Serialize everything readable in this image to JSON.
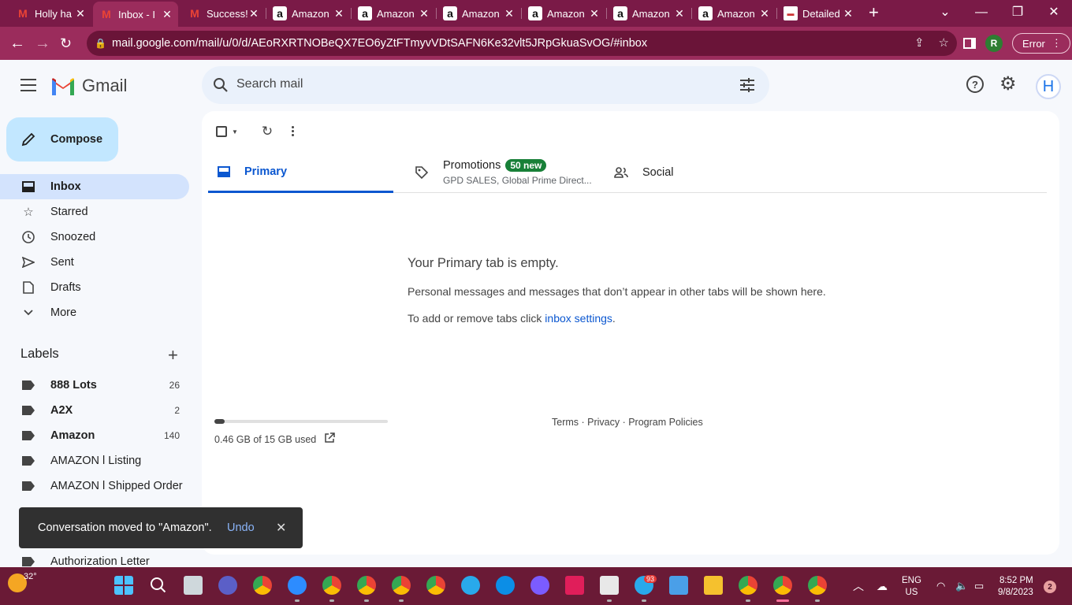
{
  "browser": {
    "tabs": [
      {
        "title": "Holly ha",
        "favicon": "gmail-icon"
      },
      {
        "title": "Inbox - I",
        "favicon": "gmail-icon",
        "active": true
      },
      {
        "title": "Success!",
        "favicon": "gmail-icon"
      },
      {
        "title": "Amazon",
        "favicon": "amazon-icon"
      },
      {
        "title": "Amazon",
        "favicon": "amazon-icon"
      },
      {
        "title": "Amazon",
        "favicon": "amazon-icon"
      },
      {
        "title": "Amazon",
        "favicon": "amazon-icon"
      },
      {
        "title": "Amazon",
        "favicon": "amazon-icon"
      },
      {
        "title": "Amazon",
        "favicon": "amazon-icon"
      },
      {
        "title": "Detailed",
        "favicon": "flag-icon"
      }
    ],
    "url": "mail.google.com/mail/u/0/d/AEoRXRTNOBeQX7EO6yZtFTmyvVDtSAFN6Ke32vlt5JRpGkuaSvOG/#inbox",
    "profile_initial": "R",
    "error_label": "Error",
    "accent_color": "#9b2c5c"
  },
  "gmail": {
    "brand": "Gmail",
    "search_placeholder": "Search mail",
    "avatar_initial": "H",
    "compose_label": "Compose",
    "nav": [
      {
        "label": "Inbox",
        "icon": "inbox-icon",
        "active": true
      },
      {
        "label": "Starred",
        "icon": "star-icon"
      },
      {
        "label": "Snoozed",
        "icon": "clock-icon"
      },
      {
        "label": "Sent",
        "icon": "send-icon"
      },
      {
        "label": "Drafts",
        "icon": "draft-icon"
      },
      {
        "label": "More",
        "icon": "chevron-down-icon"
      }
    ],
    "labels_title": "Labels",
    "labels": [
      {
        "name": "888 Lots",
        "count": "26",
        "bold": true
      },
      {
        "name": "A2X",
        "count": "2",
        "bold": true
      },
      {
        "name": "Amazon",
        "count": "140",
        "bold": true
      },
      {
        "name": "AMAZON l Listing",
        "count": ""
      },
      {
        "name": "AMAZON l Shipped Order",
        "count": ""
      },
      {
        "name": "Authorization Letter",
        "count": ""
      }
    ],
    "tabs": {
      "primary": "Primary",
      "promotions": "Promotions",
      "promotions_badge": "50 new",
      "promotions_sub": "GPD SALES, Global Prime Direct...",
      "social": "Social"
    },
    "empty": {
      "heading": "Your Primary tab is empty.",
      "line1": "Personal messages and messages that don’t appear in other tabs will be shown here.",
      "line2_prefix": "To add or remove tabs click ",
      "line2_link": "inbox settings",
      "line2_suffix": "."
    },
    "storage": {
      "text": "0.46 GB of 15 GB used",
      "fraction": 0.031
    },
    "footer": "Terms · Privacy · Program Policies",
    "snackbar": {
      "message": "Conversation moved to \"Amazon\".",
      "action": "Undo"
    }
  },
  "taskbar": {
    "temperature": "32°",
    "language": "ENG",
    "region": "US",
    "time": "8:52 PM",
    "date": "9/8/2023",
    "notifications": "2",
    "telegram_badge": "93"
  }
}
